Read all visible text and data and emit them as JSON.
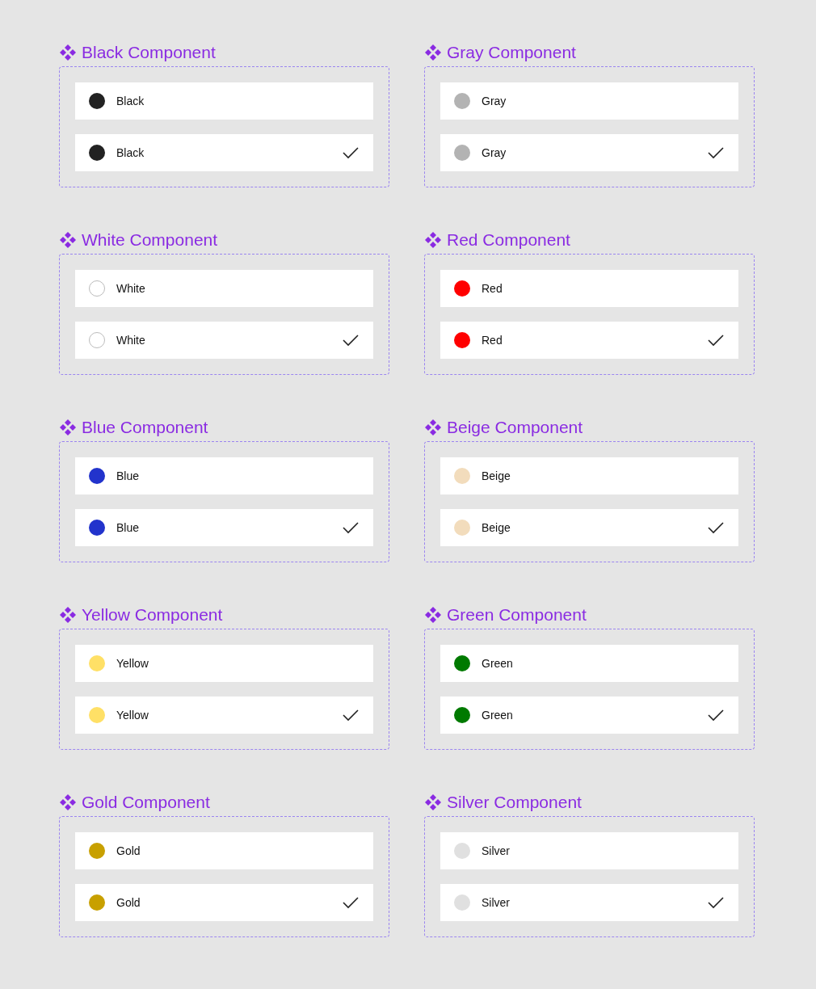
{
  "components": [
    {
      "title": "Black Component",
      "color": "#222222",
      "options": [
        {
          "label": "Black",
          "checked": false
        },
        {
          "label": "Black",
          "checked": true
        }
      ]
    },
    {
      "title": "Gray Component",
      "color": "#b3b3b3",
      "options": [
        {
          "label": "Gray",
          "checked": false
        },
        {
          "label": "Gray",
          "checked": true
        }
      ]
    },
    {
      "title": "White Component",
      "color": "#ffffff",
      "options": [
        {
          "label": "White",
          "checked": false
        },
        {
          "label": "White",
          "checked": true
        }
      ]
    },
    {
      "title": "Red Component",
      "color": "#ff0000",
      "options": [
        {
          "label": "Red",
          "checked": false
        },
        {
          "label": "Red",
          "checked": true
        }
      ]
    },
    {
      "title": "Blue Component",
      "color": "#2233cc",
      "options": [
        {
          "label": "Blue",
          "checked": false
        },
        {
          "label": "Blue",
          "checked": true
        }
      ]
    },
    {
      "title": "Beige Component",
      "color": "#f2dcbc",
      "options": [
        {
          "label": "Beige",
          "checked": false
        },
        {
          "label": "Beige",
          "checked": true
        }
      ]
    },
    {
      "title": "Yellow Component",
      "color": "#ffe066",
      "options": [
        {
          "label": "Yellow",
          "checked": false
        },
        {
          "label": "Yellow",
          "checked": true
        }
      ]
    },
    {
      "title": "Green Component",
      "color": "#007a00",
      "options": [
        {
          "label": "Green",
          "checked": false
        },
        {
          "label": "Green",
          "checked": true
        }
      ]
    },
    {
      "title": "Gold Component",
      "color": "#c8a000",
      "options": [
        {
          "label": "Gold",
          "checked": false
        },
        {
          "label": "Gold",
          "checked": true
        }
      ]
    },
    {
      "title": "Silver Component",
      "color": "#e0e0e0",
      "options": [
        {
          "label": "Silver",
          "checked": false
        },
        {
          "label": "Silver",
          "checked": true
        }
      ]
    }
  ]
}
